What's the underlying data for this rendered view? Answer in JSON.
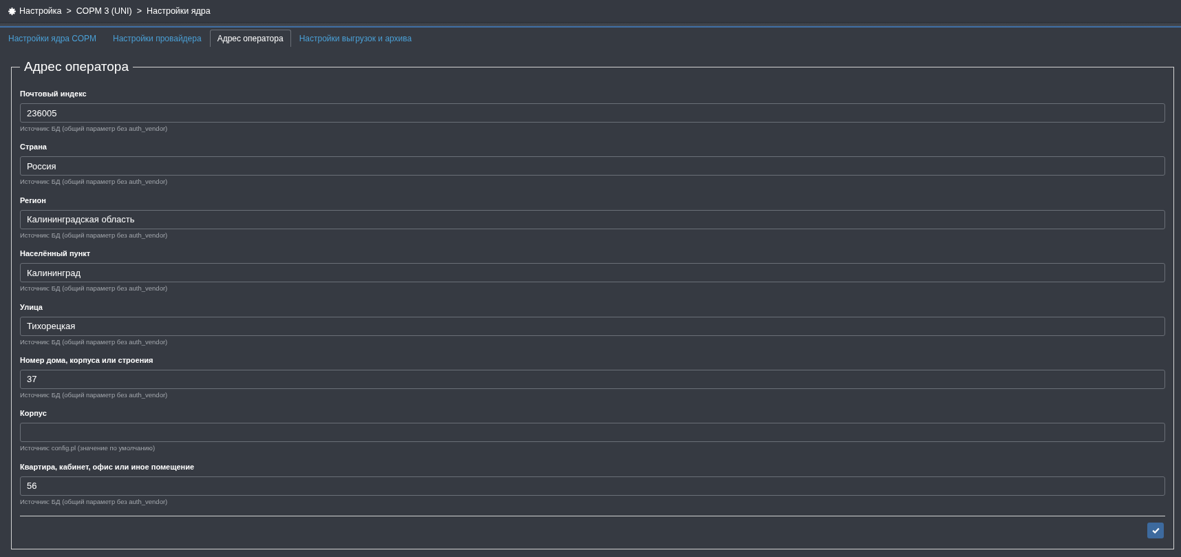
{
  "breadcrumb": {
    "items": [
      "Настройка",
      "СОРМ 3 (UNI)",
      "Настройки ядра"
    ],
    "separators": [
      ">",
      ">"
    ]
  },
  "tabs": [
    {
      "label": "Настройки ядра СОРМ",
      "selected": false
    },
    {
      "label": "Настройки провайдера",
      "selected": false
    },
    {
      "label": "Адрес оператора",
      "selected": true
    },
    {
      "label": "Настройки выгрузок и архива",
      "selected": false
    }
  ],
  "fieldset": {
    "legend": "Адрес оператора",
    "fields": [
      {
        "label": "Почтовый индекс",
        "value": "236005",
        "hint": "Источник: БД (общий параметр без auth_vendor)"
      },
      {
        "label": "Страна",
        "value": "Россия",
        "hint": "Источник: БД (общий параметр без auth_vendor)"
      },
      {
        "label": "Регион",
        "value": "Калининградская область",
        "hint": "Источник: БД (общий параметр без auth_vendor)"
      },
      {
        "label": "Населённый пункт",
        "value": "Калининград",
        "hint": "Источник: БД (общий параметр без auth_vendor)"
      },
      {
        "label": "Улица",
        "value": "Тихорецкая",
        "hint": "Источник: БД (общий параметр без auth_vendor)"
      },
      {
        "label": "Номер дома, корпуса или строения",
        "value": "37",
        "hint": "Источник: БД (общий параметр без auth_vendor)"
      },
      {
        "label": "Корпус",
        "hint": "Источник: config.pl (значение по умолчанию)"
      },
      {
        "label": "Квартира, кабинет, офис или иное помещение",
        "value": "56",
        "hint": "Источник: БД (общий параметр без auth_vendor)"
      }
    ]
  }
}
